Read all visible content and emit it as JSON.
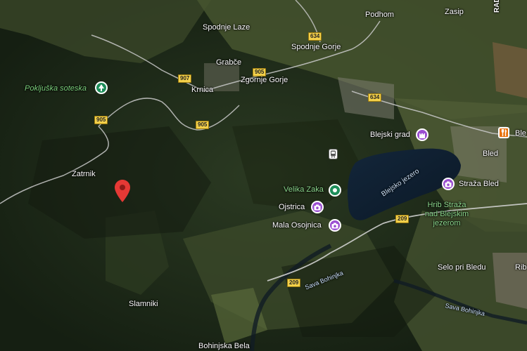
{
  "places": {
    "spodnje_laze": "Spodnje Laze",
    "grabce": "Grabče",
    "krnica": "Krnica",
    "zgornje_gorje": "Zgornje Gorje",
    "spodnje_gorje": "Spodnje Gorje",
    "podhom": "Podhom",
    "zasip": "Zasip",
    "zatrnik": "Zatrnik",
    "slamniki": "Slamniki",
    "bohinjska_bela": "Bohinjska Bela",
    "bled": "Bled",
    "selo": "Selo pri Bledu",
    "rib": "Rib",
    "ble": "Ble",
    "rad": "RAD"
  },
  "pois": {
    "pokljuska": "Pokljuška soteska",
    "blejski_grad": "Blejski grad",
    "velika_zaka": "Velika Zaka",
    "ojstrica": "Ojstrica",
    "mala_osojnica": "Mala Osojnica",
    "straza_bled": "Straža Bled",
    "hrib_straza_1": "Hrib Straža",
    "hrib_straza_2": "nad Blejskim",
    "hrib_straza_3": "jezerom"
  },
  "water": {
    "blejsko_jezero": "Blejsko jezero",
    "sava_bohinjka_1": "Sava Bohinjka",
    "sava_bohinjka_2": "Sava Bohinjka"
  },
  "roads": {
    "r907": "907",
    "r905a": "905",
    "r905b": "905",
    "r905c": "905",
    "r634a": "634",
    "r634b": "634",
    "r209a": "209",
    "r209b": "209"
  },
  "icons": {
    "selected_pin": "red-location-pin-icon",
    "park": "tree-icon",
    "castle": "castle-icon",
    "camera": "camera-icon",
    "restaurant": "fork-knife-icon",
    "transit": "bus-stop-icon",
    "green_poi": "green-circle-poi-icon"
  },
  "colors": {
    "pin": "#e53935",
    "poi_purple": "#9b4fd1",
    "poi_green": "#1e8e5a",
    "road_shield": "#f3d04a",
    "lake": "#0f1e2e"
  }
}
